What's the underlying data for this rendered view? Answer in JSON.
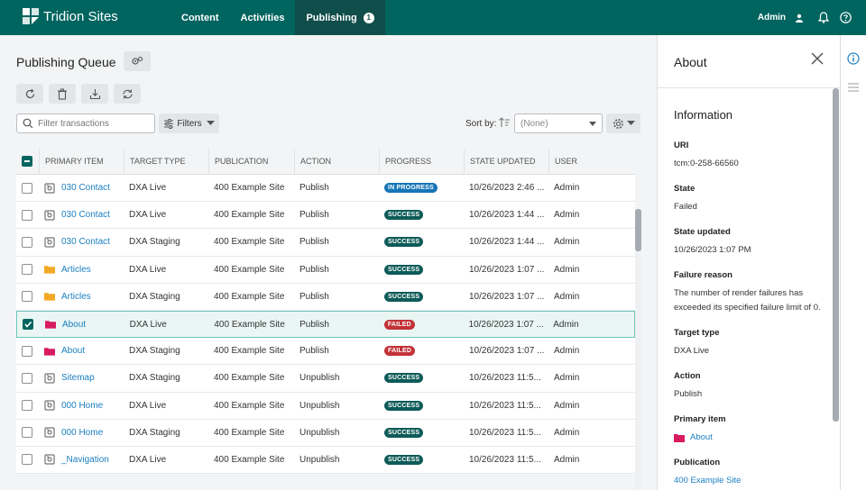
{
  "app": {
    "brand": "Tridion Sites",
    "nav": [
      {
        "label": "Content"
      },
      {
        "label": "Activities"
      },
      {
        "label": "Publishing",
        "badge": "1"
      }
    ],
    "user": "Admin"
  },
  "page": {
    "title": "Publishing Queue",
    "search_placeholder": "Filter transactions",
    "filters_label": "Filters",
    "sort_label": "Sort by:",
    "sort_value": "(None)"
  },
  "table": {
    "columns": [
      "PRIMARY ITEM",
      "TARGET TYPE",
      "PUBLICATION",
      "ACTION",
      "PROGRESS",
      "STATE UPDATED",
      "USER"
    ],
    "rows": [
      {
        "item": "030 Contact",
        "icon": "page-icon",
        "target": "DXA Live",
        "publication": "400 Example Site",
        "action": "Publish",
        "progress": "IN PROGRESS",
        "status": "progress",
        "updated": "10/26/2023 2:46 ...",
        "user": "Admin",
        "selected": false
      },
      {
        "item": "030 Contact",
        "icon": "page-icon",
        "target": "DXA Live",
        "publication": "400 Example Site",
        "action": "Publish",
        "progress": "SUCCESS",
        "status": "success",
        "updated": "10/26/2023 1:44 ...",
        "user": "Admin",
        "selected": false
      },
      {
        "item": "030 Contact",
        "icon": "page-icon",
        "target": "DXA Staging",
        "publication": "400 Example Site",
        "action": "Publish",
        "progress": "SUCCESS",
        "status": "success",
        "updated": "10/26/2023 1:44 ...",
        "user": "Admin",
        "selected": false
      },
      {
        "item": "Articles",
        "icon": "folder-icon",
        "target": "DXA Live",
        "publication": "400 Example Site",
        "action": "Publish",
        "progress": "SUCCESS",
        "status": "success",
        "updated": "10/26/2023 1:07 ...",
        "user": "Admin",
        "selected": false
      },
      {
        "item": "Articles",
        "icon": "folder-icon",
        "target": "DXA Staging",
        "publication": "400 Example Site",
        "action": "Publish",
        "progress": "SUCCESS",
        "status": "success",
        "updated": "10/26/2023 1:07 ...",
        "user": "Admin",
        "selected": false
      },
      {
        "item": "About",
        "icon": "structure-group-icon",
        "target": "DXA Live",
        "publication": "400 Example Site",
        "action": "Publish",
        "progress": "FAILED",
        "status": "failed",
        "updated": "10/26/2023 1:07 ...",
        "user": "Admin",
        "selected": true
      },
      {
        "item": "About",
        "icon": "structure-group-icon",
        "target": "DXA Staging",
        "publication": "400 Example Site",
        "action": "Publish",
        "progress": "FAILED",
        "status": "failed",
        "updated": "10/26/2023 1:07 ...",
        "user": "Admin",
        "selected": false
      },
      {
        "item": "Sitemap",
        "icon": "page-icon",
        "target": "DXA Staging",
        "publication": "400 Example Site",
        "action": "Unpublish",
        "progress": "SUCCESS",
        "status": "success",
        "updated": "10/26/2023 11:5...",
        "user": "Admin",
        "selected": false
      },
      {
        "item": "000 Home",
        "icon": "page-icon",
        "target": "DXA Live",
        "publication": "400 Example Site",
        "action": "Unpublish",
        "progress": "SUCCESS",
        "status": "success",
        "updated": "10/26/2023 11:5...",
        "user": "Admin",
        "selected": false
      },
      {
        "item": "000 Home",
        "icon": "page-icon",
        "target": "DXA Staging",
        "publication": "400 Example Site",
        "action": "Unpublish",
        "progress": "SUCCESS",
        "status": "success",
        "updated": "10/26/2023 11:5...",
        "user": "Admin",
        "selected": false
      },
      {
        "item": "_Navigation",
        "icon": "page-icon",
        "target": "DXA Live",
        "publication": "400 Example Site",
        "action": "Unpublish",
        "progress": "SUCCESS",
        "status": "success",
        "updated": "10/26/2023 11:5...",
        "user": "Admin",
        "selected": false
      }
    ]
  },
  "panel": {
    "title": "About",
    "section": "Information",
    "fields": {
      "uri": {
        "label": "URI",
        "value": "tcm:0-258-66560"
      },
      "state": {
        "label": "State",
        "value": "Failed"
      },
      "state_updated": {
        "label": "State updated",
        "value": "10/26/2023 1:07 PM"
      },
      "failure_reason": {
        "label": "Failure reason",
        "value": "The number of render failures has exceeded its specified failure limit of 0."
      },
      "target_type": {
        "label": "Target type",
        "value": "DXA Live"
      },
      "action": {
        "label": "Action",
        "value": "Publish"
      },
      "primary_item": {
        "label": "Primary item",
        "value": "About"
      },
      "publication": {
        "label": "Publication",
        "value": "400 Example Site"
      }
    }
  },
  "colors": {
    "topbar": "#00645f",
    "nav_active": "#0f4e4a",
    "link": "#1a7fc1",
    "success": "#0d5b58",
    "in_progress": "#1676b7",
    "failed": "#c23237",
    "folder": "#f3a925",
    "structure_group": "#d81b60"
  }
}
